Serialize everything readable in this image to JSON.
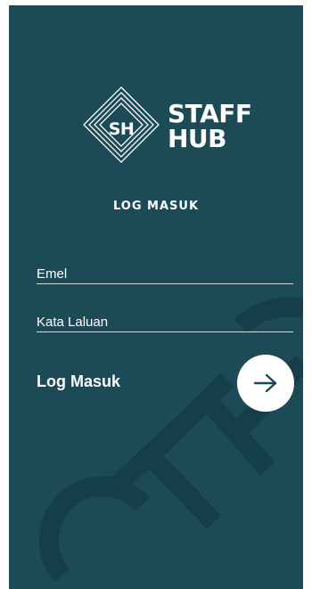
{
  "app": {
    "brand_line1": "STAFF",
    "brand_line2": "HUB",
    "monogram": "SH"
  },
  "screen_title": "LOG MASUK",
  "form": {
    "email_placeholder": "Emel",
    "password_placeholder": "Kata Laluan",
    "submit_label": "Log Masuk"
  },
  "icons": {
    "submit": "arrow-right-icon",
    "logo": "diamond-logo-icon"
  },
  "colors": {
    "background": "#1c4a57",
    "text": "#ffffff",
    "button": "#ffffff",
    "button_icon": "#1c4a57",
    "watermark": "#173f4a"
  }
}
